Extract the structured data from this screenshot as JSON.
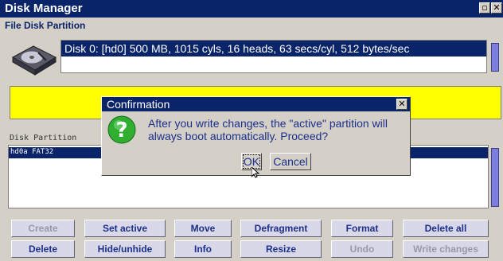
{
  "window": {
    "title": "Disk Manager"
  },
  "menu": {
    "label": "File Disk Partition"
  },
  "disk": {
    "info": "Disk 0: [hd0] 500 MB, 1015 cyls, 16 heads, 63 secs/cyl, 512 bytes/sec"
  },
  "partition_section": {
    "label": "Disk Partition",
    "rows": [
      "hd0a FAT32"
    ]
  },
  "buttons_row1": [
    {
      "label": "Create",
      "enabled": false
    },
    {
      "label": "Set active",
      "enabled": true
    },
    {
      "label": "Move",
      "enabled": true
    },
    {
      "label": "Defragment",
      "enabled": true
    },
    {
      "label": "Format",
      "enabled": true
    },
    {
      "label": "Delete all",
      "enabled": true
    }
  ],
  "buttons_row2": [
    {
      "label": "Delete",
      "enabled": true
    },
    {
      "label": "Hide/unhide",
      "enabled": true
    },
    {
      "label": "Info",
      "enabled": true
    },
    {
      "label": "Resize",
      "enabled": true
    },
    {
      "label": "Undo",
      "enabled": false
    },
    {
      "label": "Write changes",
      "enabled": false
    }
  ],
  "dialog": {
    "title": "Confirmation",
    "message": "After you write changes, the \"active\" partition will always boot automatically.  Proceed?",
    "ok_label": "OK",
    "cancel_label": "Cancel"
  },
  "colors": {
    "title_bar": "#0a246a",
    "highlight": "#ffff00",
    "scroll_thumb": "#7b80e0"
  }
}
